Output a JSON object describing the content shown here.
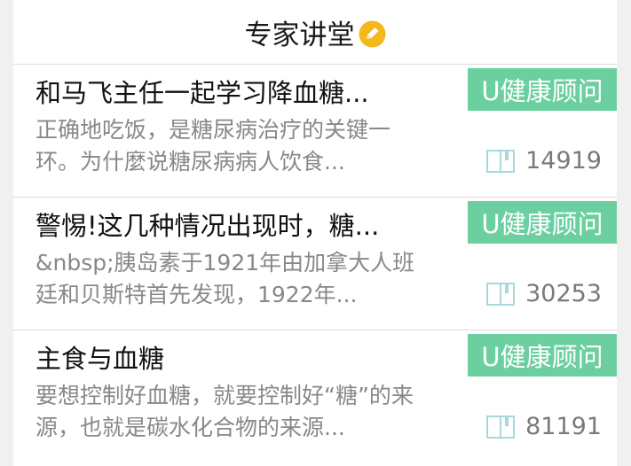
{
  "header": {
    "title": "专家讲堂",
    "icon": "edit-badge-icon",
    "icon_color": "#f5b81c"
  },
  "colors": {
    "badge_bg": "#6ccfa0",
    "divider": "#dcdcdc"
  },
  "articles": [
    {
      "title": "和马飞主任一起学习降血糖...",
      "summary": "正确地吃饭，是糖尿病治疗的关键一\n环。为什麼说糖尿病病人饮食...",
      "badge": "U健康顾问",
      "views": "14919",
      "views_icon": "book-icon"
    },
    {
      "title": "警惕!这几种情况出现时，糖...",
      "summary": "&nbsp;胰岛素于1921年由加拿大人班\n廷和贝斯特首先发现，1922年...",
      "badge": "U健康顾问",
      "views": "30253",
      "views_icon": "book-icon"
    },
    {
      "title": "主食与血糖",
      "summary": "要想控制好血糖，就要控制好“糖”的来\n源，也就是碳水化合物的来源...",
      "badge": "U健康顾问",
      "views": "81191",
      "views_icon": "book-icon"
    }
  ]
}
